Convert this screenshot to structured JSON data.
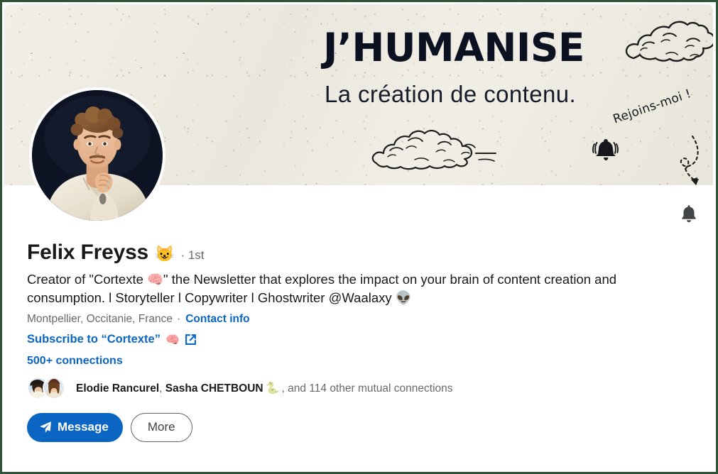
{
  "banner": {
    "headline": "J’HUMANISE",
    "subline": "La création de contenu.",
    "handwritten_note": "Rejoins-moi !",
    "background_color": "#ece9e0",
    "doodles": [
      "cloud-doodle",
      "cloud-doodle",
      "bell-doodle",
      "curved-dashed-arrow-doodle"
    ]
  },
  "notify": {
    "icon": "bell-icon"
  },
  "profile": {
    "name": "Felix Freyss",
    "name_emoji": "😺",
    "degree": "· 1st",
    "headline": "Creator of \"Cortexte 🧠\" the Newsletter that explores the impact on your brain of content creation and consumption. l Storyteller l Copywriter l Ghostwriter @Waalaxy 👽",
    "location": "Montpellier, Occitanie, France",
    "location_separator": "·",
    "contact_info_label": "Contact info",
    "subscribe_label": "Subscribe to “Cortexte”",
    "subscribe_emoji": "🧠",
    "subscribe_icon": "external-link-icon",
    "connections_label": "500+ connections",
    "mutual": {
      "name_1": "Elodie Rancurel",
      "name_2": "Sasha CHETBOUN",
      "name_2_emoji": "🐍",
      "suffix": ", and 114 other mutual connections",
      "other_count": "114"
    }
  },
  "actions": {
    "message_label": "Message",
    "message_icon": "send-plane-icon",
    "more_label": "More"
  },
  "colors": {
    "link_blue": "#0a66c2",
    "frame_green": "#2d5436",
    "banner_paper": "#ece9e0",
    "headline_ink": "#0c1122"
  }
}
